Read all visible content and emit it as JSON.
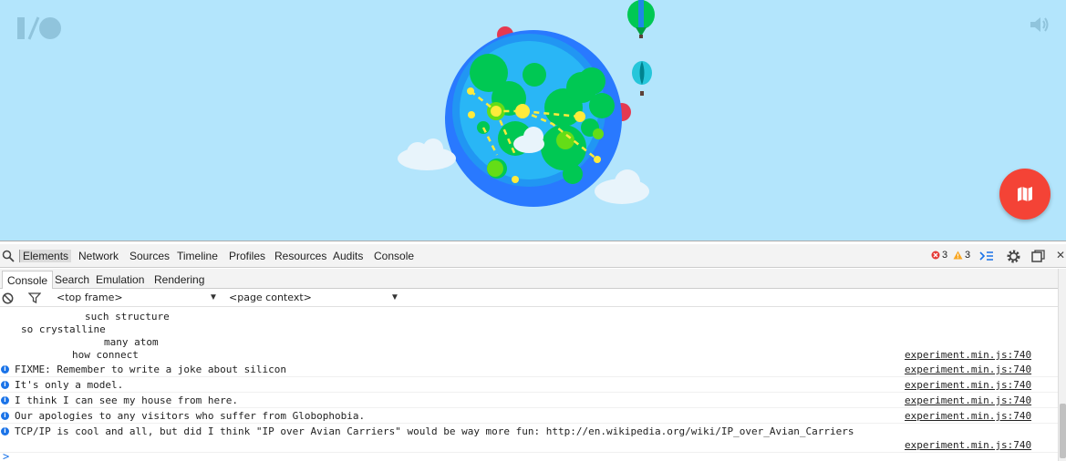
{
  "viewport": {
    "logo_text": "I/O",
    "background": "#b3e5fc",
    "map_button_color": "#f44336",
    "icons": [
      "io-logo-icon",
      "speaker-icon",
      "map-icon"
    ]
  },
  "devtools": {
    "main_tabs": [
      {
        "label": "Elements",
        "active": true
      },
      {
        "label": "Network"
      },
      {
        "label": "Sources"
      },
      {
        "label": "Timeline"
      },
      {
        "label": "Profiles"
      },
      {
        "label": "Resources"
      },
      {
        "label": "Audits"
      },
      {
        "label": "Console"
      }
    ],
    "error_count": "3",
    "warning_count": "3",
    "sub_tabs": [
      {
        "label": "Console",
        "active": true
      },
      {
        "label": "Search"
      },
      {
        "label": "Emulation"
      },
      {
        "label": "Rendering"
      }
    ],
    "frame_select": "<top frame>",
    "context_select": "<page context>",
    "console": {
      "doge_lines": [
        "such structure",
        "so crystalline",
        "many atom",
        "how connect"
      ],
      "doge_source": "experiment.min.js:740",
      "messages": [
        {
          "text": "FIXME: Remember to write a joke about silicon",
          "source": "experiment.min.js:740"
        },
        {
          "text": "It's only a model.",
          "source": "experiment.min.js:740"
        },
        {
          "text": "I think I can see my house from here.",
          "source": "experiment.min.js:740"
        },
        {
          "text": "Our apologies to any visitors who suffer from Globophobia.",
          "source": "experiment.min.js:740"
        },
        {
          "text": "TCP/IP is cool and all, but did I think \"IP over Avian Carriers\" would be way more fun: http://en.wikipedia.org/wiki/IP_over_Avian_Carriers",
          "source": "experiment.min.js:740"
        }
      ],
      "prompt": ">"
    }
  }
}
